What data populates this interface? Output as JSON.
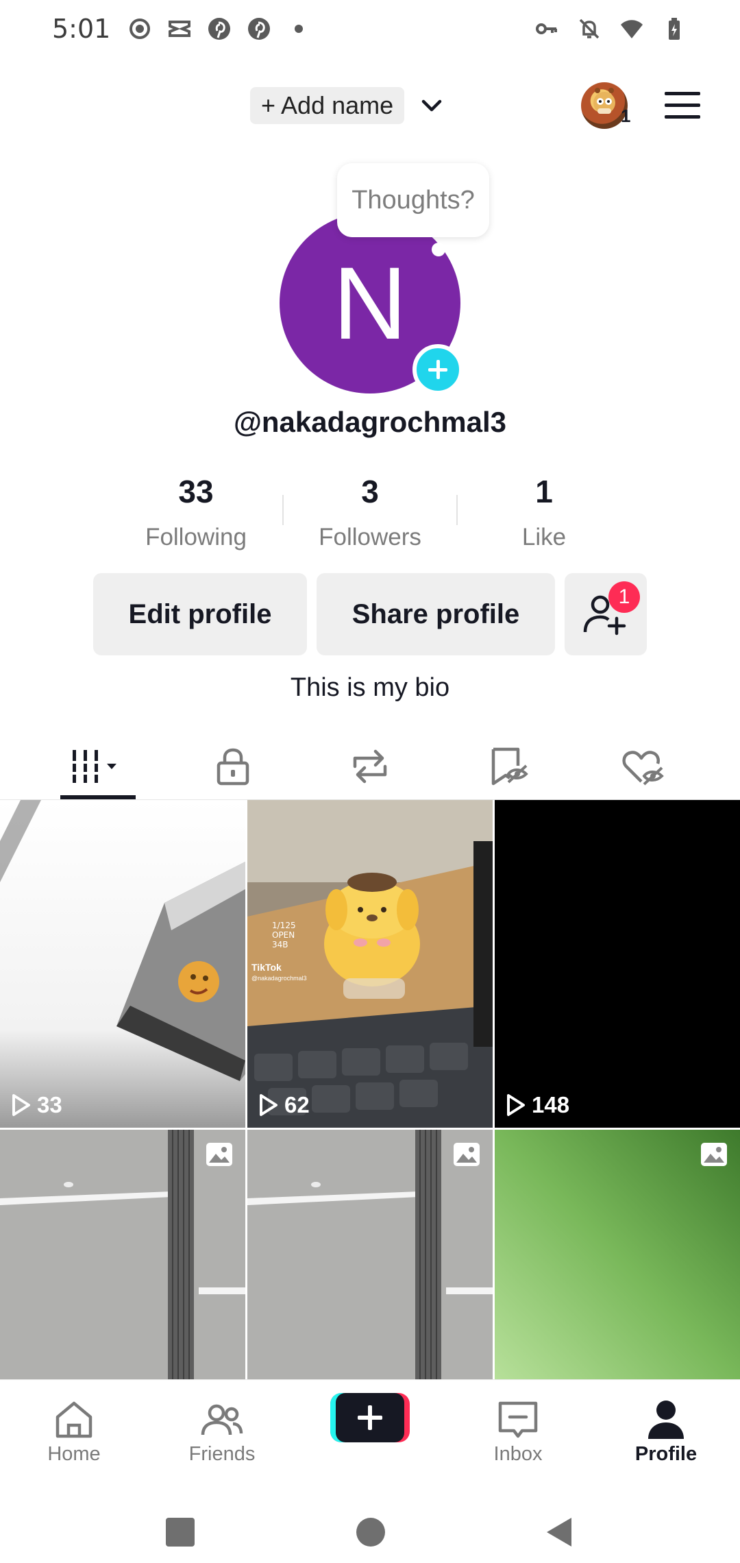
{
  "status_bar": {
    "time": "5:01",
    "left_icons": [
      "record-icon",
      "capcut-icon",
      "pinterest-icon",
      "pinterest-icon",
      "dot-icon"
    ],
    "right_icons": [
      "vpn-key-icon",
      "bell-muted-icon",
      "wifi-icon",
      "battery-charging-icon"
    ]
  },
  "header": {
    "add_name_label": "+ Add name",
    "account_switch_count": "1"
  },
  "profile": {
    "avatar_letter": "N",
    "avatar_color": "#7b27a6",
    "thoughts_bubble": "Thoughts?",
    "username": "@nakadagrochmal3",
    "bio": "This is my bio"
  },
  "stats": [
    {
      "value": "33",
      "label": "Following"
    },
    {
      "value": "3",
      "label": "Followers"
    },
    {
      "value": "1",
      "label": "Like"
    }
  ],
  "buttons": {
    "edit_profile": "Edit profile",
    "share_profile": "Share profile",
    "add_friends_badge": "1"
  },
  "tabs": [
    {
      "icon": "videos-grid-icon",
      "active": true
    },
    {
      "icon": "lock-icon",
      "active": false
    },
    {
      "icon": "repost-icon",
      "active": false
    },
    {
      "icon": "favorites-hidden-icon",
      "active": false
    },
    {
      "icon": "liked-hidden-icon",
      "active": false
    }
  ],
  "videos": [
    {
      "views": "33",
      "type": "video",
      "thumb": "spinning-box"
    },
    {
      "views": "62",
      "type": "video",
      "thumb": "pompompurin-figure",
      "overlay_lines": [
        "1/125",
        "OPEN",
        "34B",
        "TikTok",
        "@nakadagrochmal3"
      ]
    },
    {
      "views": "148",
      "type": "video",
      "thumb": "black"
    },
    {
      "views": "",
      "type": "photo",
      "thumb": "ceiling-light"
    },
    {
      "views": "",
      "type": "photo",
      "thumb": "ceiling-light"
    },
    {
      "views": "",
      "type": "photo",
      "thumb": "green-blur"
    }
  ],
  "bottom_nav": [
    {
      "label": "Home",
      "icon": "home-icon",
      "active": false
    },
    {
      "label": "Friends",
      "icon": "friends-icon",
      "active": false
    },
    {
      "label": "",
      "icon": "create-plus-icon",
      "active": false
    },
    {
      "label": "Inbox",
      "icon": "inbox-icon",
      "active": false
    },
    {
      "label": "Profile",
      "icon": "profile-icon",
      "active": true
    }
  ],
  "colors": {
    "accent_red": "#fe2c55",
    "accent_cyan": "#25f4ee",
    "add_button": "#20d5ec",
    "text_primary": "#161823"
  }
}
